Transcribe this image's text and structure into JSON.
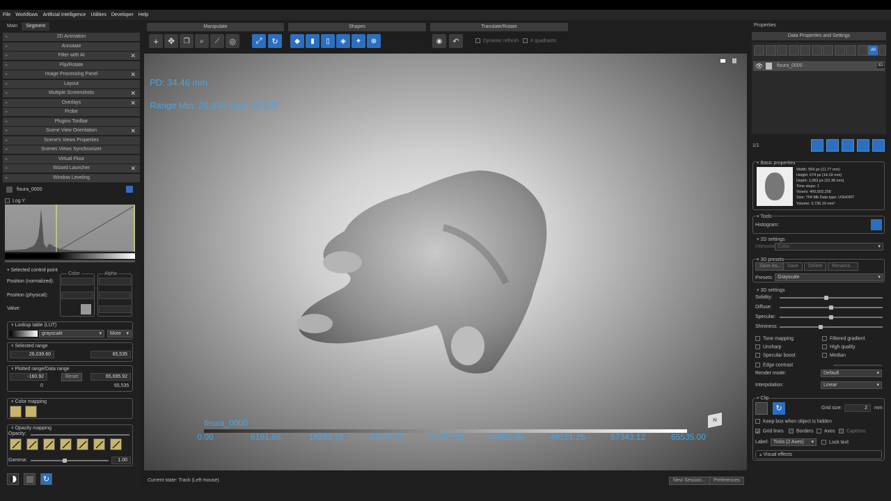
{
  "menu": [
    "File",
    "Workflows",
    "Artificial Intelligence",
    "Utilities",
    "Developer",
    "Help"
  ],
  "left": {
    "tabs": [
      "Main",
      "Segment"
    ],
    "plugins": [
      {
        "label": "2D Animation",
        "closable": false
      },
      {
        "label": "Annotate",
        "closable": false
      },
      {
        "label": "Filter with AI",
        "closable": true
      },
      {
        "label": "Flip/Rotate",
        "closable": false
      },
      {
        "label": "Image Processing Panel",
        "closable": true
      },
      {
        "label": "Layout",
        "closable": false
      },
      {
        "label": "Multiple Screenshots",
        "closable": true
      },
      {
        "label": "Overlays",
        "closable": true
      },
      {
        "label": "Probe",
        "closable": false
      },
      {
        "label": "Plugins Toolbar",
        "closable": false
      },
      {
        "label": "Scene View Orientation",
        "closable": true
      },
      {
        "label": "Scene's Views Properties",
        "closable": false
      },
      {
        "label": "Scenes Views Synchronizer",
        "closable": false
      },
      {
        "label": "Virtual Floor",
        "closable": false
      },
      {
        "label": "Wizard Launcher",
        "closable": true
      },
      {
        "label": "Window Leveling",
        "closable": false
      }
    ],
    "object_name": "fisura_0000",
    "log_y": "Log Y",
    "selected_control_point": "Selected control point",
    "pos_normalized": "Position (normalized):",
    "pos_physical": "Position (physical):",
    "value": "Value:",
    "color": "Color",
    "alpha": "Alpha",
    "lut_title": "Lookup table (LUT)",
    "lut_value": "grayscale",
    "more": "More",
    "selected_range": "Selected range",
    "sel_min": "26,039.60",
    "sel_max": "65,535",
    "plotted_range": "Plotted range/Data range",
    "plot_min": "-160.92",
    "reset": "Reset",
    "plot_max": "65,695.92",
    "data_min": "0",
    "data_max": "65,535",
    "color_mapping": "Color mapping",
    "opacity_mapping": "Opacity mapping",
    "opacity": "Opacity:",
    "gamma": "Gamma:",
    "gamma_value": "1.00"
  },
  "toolbar": {
    "groups": [
      "Manipulate",
      "Shapes",
      "Translate/Rotate"
    ],
    "dynamic_refresh": "Dynamic refresh",
    "four_quadrants": "4 quadrants"
  },
  "viewport": {
    "pd": "PD: 34.46 mm",
    "range": "Range Min: 26,040 Max: 65,535",
    "colorbar_title": "fisura_0000",
    "colorbar_ticks": [
      "0.00",
      "8191.88",
      "16383.75",
      "24575.62",
      "32767.50",
      "40959.38",
      "49151.25",
      "57343.12",
      "65535.00"
    ]
  },
  "status": {
    "current_state": "Current state: Track (Left mouse)",
    "new_session": "New Session...",
    "preferences": "Preferences"
  },
  "right": {
    "title": "Properties",
    "data_props": "Data Properties and Settings",
    "all": "All",
    "item": "fisura_0000",
    "badge_3d": "3D",
    "count": "1/1",
    "basic_props": "Basic properties",
    "info": [
      "Width: 559 px (11.77 mm)",
      "Height: 674 px (14.19 mm)",
      "Depth: 1,063 px (22.38 mm)",
      "Time steps: 1",
      "Voxels: 400,502,258",
      "Size: 764 Mb  Data type: USHORT",
      "Volume: 3,736.19 mm³"
    ],
    "tools": "Tools",
    "histogram": "Histogram:",
    "settings2d": "2D settings",
    "interp2d_label": "Interpolation:",
    "interp2d_value": "Cubic",
    "presets3d": "3D presets",
    "save_as": "Save As...",
    "save": "Save",
    "delete": "Delete",
    "rename": "Rename...",
    "presets_label": "Presets:",
    "presets_value": "Grayscale",
    "settings3d": "3D settings",
    "sliders": [
      {
        "label": "Solidity:",
        "value": 0.45
      },
      {
        "label": "Diffuse:",
        "value": 0.5
      },
      {
        "label": "Specular:",
        "value": 0.5
      },
      {
        "label": "Shininess:",
        "value": 0.4
      }
    ],
    "checks_left": [
      "Tone mapping",
      "Unsharp",
      "Specular boost",
      "Edge contrast"
    ],
    "checks_right": [
      "Filtered gradient",
      "High quality",
      "Median"
    ],
    "render_mode_label": "Render mode:",
    "render_mode": "Default",
    "interp3d_label": "Interpolation:",
    "interp3d": "Linear",
    "clip": "Clip",
    "grid_size_label": "Grid size:",
    "grid_size": "2",
    "grid_unit": "mm",
    "keep_box": "Keep box when object is hidden",
    "grid_lines": "Grid lines",
    "borders": "Borders",
    "axes": "Axes",
    "captions": "Captions",
    "label_label": "Label:",
    "label_value": "Ticks (2 Axes)",
    "lock_text": "Lock text",
    "visual_effects": "Visual effects"
  }
}
